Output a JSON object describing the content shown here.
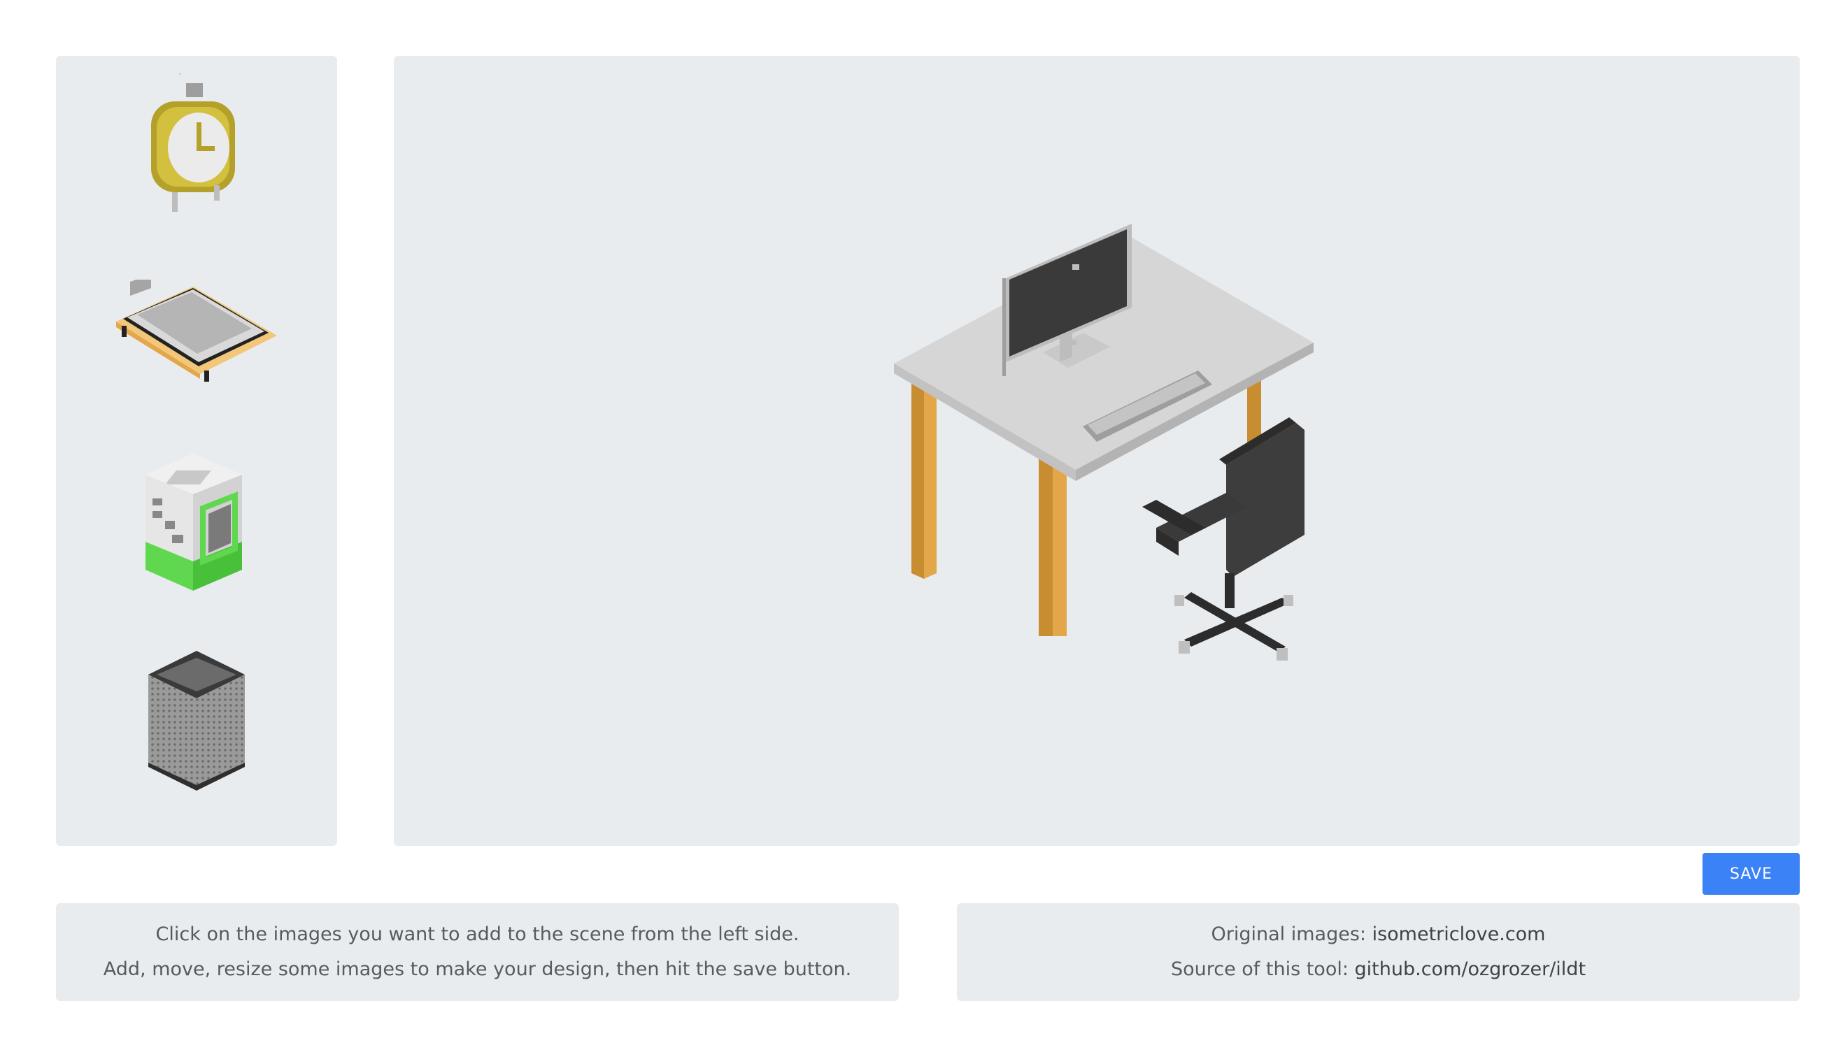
{
  "sidebar": {
    "items": [
      {
        "icon": "alarm-clock-icon"
      },
      {
        "icon": "keyboard-on-tray-icon"
      },
      {
        "icon": "printer-cabinet-icon"
      },
      {
        "icon": "mesh-trash-bin-icon"
      }
    ]
  },
  "scene": {
    "items": [
      {
        "icon": "desk-with-monitor-icon"
      },
      {
        "icon": "office-chair-icon"
      }
    ]
  },
  "toolbar": {
    "save_label": "SAVE",
    "save_color": "#3b82f6"
  },
  "instructions": {
    "line1": "Click on the images you want to add to the scene from the left side.",
    "line2": "Add, move, resize some images to make your design, then hit the save button."
  },
  "credits": {
    "original_prefix": "Original images: ",
    "original_link": "isometriclove.com",
    "source_prefix": "Source of this tool: ",
    "source_link": "github.com/ozgrozer/ildt"
  },
  "colors": {
    "panel": "#e9ecef",
    "desk_leg": "#e3a74a",
    "chair": "#3d3d3d",
    "clock": "#b5a02a",
    "printer_base": "#5fd84f"
  }
}
